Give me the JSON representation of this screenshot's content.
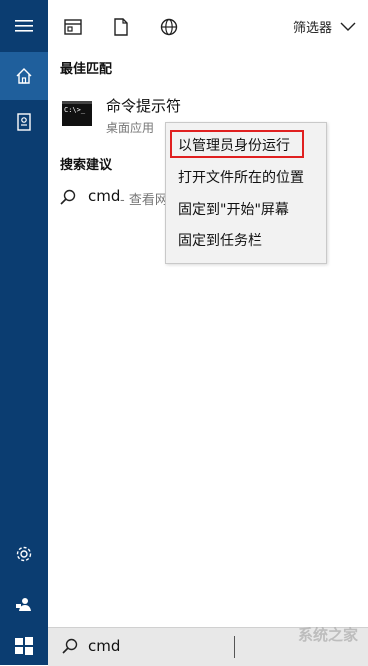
{
  "rail": {
    "items": [
      {
        "name": "hamburger-menu-icon"
      },
      {
        "name": "home-icon"
      },
      {
        "name": "notebook-icon"
      },
      {
        "name": "settings-gear-icon"
      },
      {
        "name": "feedback-person-icon"
      }
    ],
    "colors": {
      "background": "#0b3d71",
      "active": "#1f5f9c"
    }
  },
  "topbar": {
    "icons": [
      "apps-icon",
      "document-icon",
      "web-globe-icon"
    ],
    "filter_label": "筛选器"
  },
  "best_match": {
    "heading": "最佳匹配",
    "result": {
      "title": "命令提示符",
      "subtitle": "桌面应用",
      "icon_text": "C:\\>_"
    }
  },
  "suggestions": {
    "heading": "搜索建议",
    "items": [
      {
        "text": "cmd",
        "more": "- 查看网"
      }
    ]
  },
  "context_menu": {
    "items": [
      {
        "label": "以管理员身份运行",
        "highlighted": true
      },
      {
        "label": "打开文件所在的位置"
      },
      {
        "label": "固定到\"开始\"屏幕"
      },
      {
        "label": "固定到任务栏"
      }
    ],
    "highlight_color": "#e02020"
  },
  "searchbar": {
    "value": "cmd"
  },
  "watermark": "系统之家"
}
